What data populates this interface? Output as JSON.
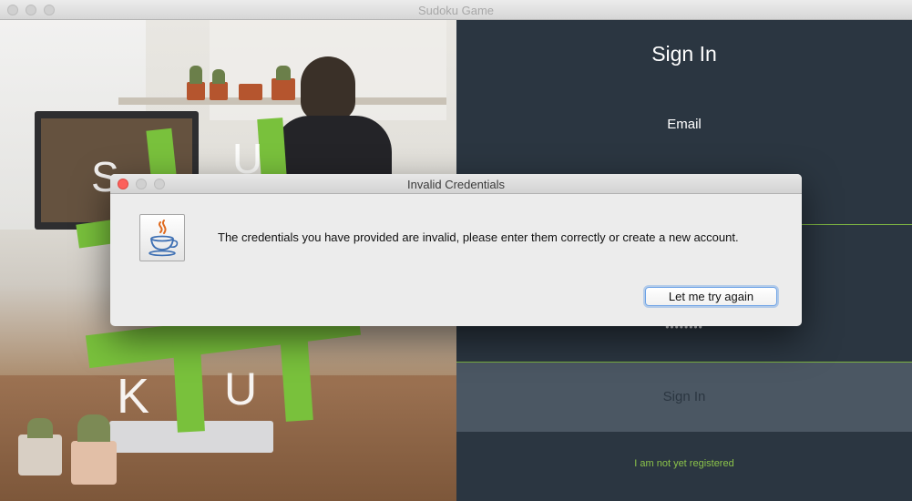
{
  "window": {
    "title": "Sudoku Game"
  },
  "background_letters": {
    "top": [
      "S",
      "U"
    ],
    "bottom": [
      "K",
      "U"
    ]
  },
  "signin_panel": {
    "title": "Sign In",
    "email_label": "Email",
    "password_mask": "••••••••",
    "signin_button": "Sign In",
    "register_link": "I am not yet registered",
    "accent_color": "#7cb342",
    "background_color": "#2b3641"
  },
  "dialog": {
    "title": "Invalid Credentials",
    "icon": "java-cup-icon",
    "message": "The credentials you have provided are invalid, please enter them correctly or create a new account.",
    "button": "Let me try again"
  }
}
